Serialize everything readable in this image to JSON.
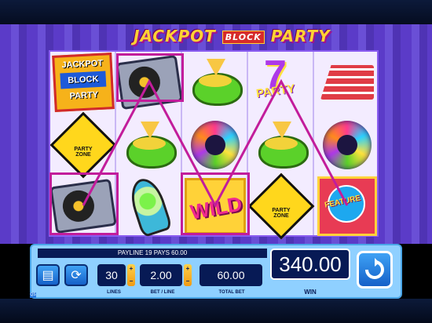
{
  "game": {
    "title_part1": "JACKPOT",
    "title_mid": "BLOCK",
    "title_part2": "PARTY"
  },
  "reels": [
    [
      "jackpot-block-party-logo",
      "party-zone-sign",
      "turntable"
    ],
    [
      "turntable",
      "guacamole-bowl",
      "lava-lamp"
    ],
    [
      "guacamole-bowl",
      "disco-ball",
      "wild"
    ],
    [
      "party-7",
      "guacamole-bowl",
      "party-zone-sign"
    ],
    [
      "cake-slice",
      "disco-ball",
      "feature"
    ]
  ],
  "symbol_text": {
    "logo_line1": "JACKPOT",
    "logo_line2": "BLOCK",
    "logo_line3": "PARTY",
    "party_zone": "PARTY ZONE",
    "party_7_num": "7",
    "party_7_text": "PARTY",
    "wild": "WILD",
    "feature": "FEATURE"
  },
  "payline_message": "PAYLINE 19 PAYS 60.00",
  "controls": {
    "lines_value": "30",
    "lines_label": "LINES",
    "bet_per_line_value": "2.00",
    "bet_per_line_label": "BET / LINE",
    "total_bet_value": "60.00",
    "total_bet_label": "TOTAL BET",
    "win_value": "340.00",
    "win_label": "WIN",
    "plus": "+",
    "minus": "−",
    "quick_spin": "QS"
  },
  "colors": {
    "highlight": "#c21d9b",
    "panel": "#8fd0ff",
    "display": "#071a55"
  },
  "icons": [
    "paytable-icon",
    "autoplay-icon",
    "spin-icon"
  ]
}
